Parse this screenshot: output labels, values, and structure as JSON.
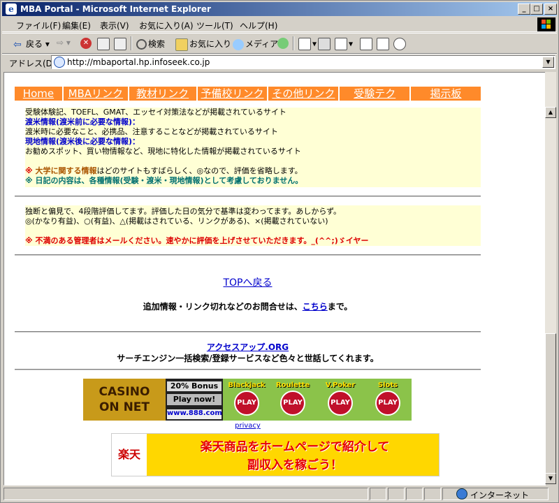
{
  "window": {
    "title": "MBA Portal - Microsoft Internet Explorer"
  },
  "menu": [
    "ファイル(F)",
    "編集(E)",
    "表示(V)",
    "お気に入り(A)",
    "ツール(T)",
    "ヘルプ(H)"
  ],
  "toolbar": {
    "back": "戻る",
    "search": "検索",
    "favorites": "お気に入り",
    "media": "メディア"
  },
  "address": {
    "label": "アドレス(D)",
    "url": "http://mbaportal.hp.infoseek.co.jp"
  },
  "nav": [
    "Home",
    "MBAリンク",
    "教材リンク",
    "予備校リンク",
    "その他リンク",
    "受験テク",
    "掲示板"
  ],
  "legend": {
    "line1": "受験体験記、TOEFL、GMAT、エッセイ対策法などが掲載されているサイト",
    "pre_title": "渡米情報(渡米前に必要な情報)：",
    "pre_desc": "渡米時に必要なこと、必携品、注意することなどが掲載されているサイト",
    "local_title": "現地情報(渡米後に必要な情報)：",
    "local_desc": "お勧めスポット、買い物情報など、現地に特化した情報が掲載されているサイト",
    "note1_mark": "※ ",
    "note1_strong": "大学に関する情報",
    "note1_rest": "はどのサイトもすばらしく、◎なので、評価を省略します。",
    "note2": "※ 日記の内容は、各種情報(受験・渡米・現地情報)として考慮しておりません。"
  },
  "rating": {
    "line1": "独断と偏見で、4段階評価してます。評価した日の気分で基準は変わってます。あしからず。",
    "line2": "◎(かなり有益)、○(有益)、△(掲載はされている、リンクがある)、×(掲載されていない)",
    "note": "※ 不満のある管理者はメールください。速やかに評価を上げさせていただきます。_(^^;)ゞイヤー"
  },
  "top_link": "TOPへ戻る",
  "contact": {
    "text": "追加情報・リンク切れなどのお問合せは、",
    "link": "こちら",
    "suffix": "まで。"
  },
  "access_up": {
    "link": "アクセスアップ.ORG",
    "desc": "サーチエンジン一括検索/登録サービスなど色々と世話してくれます。"
  },
  "casino": {
    "logo_top": "CASINO",
    "logo_bottom": "ON NET",
    "bonus": "20% Bonus",
    "play": "Play now!",
    "site": "www.888.com",
    "games": [
      "Blackjack",
      "Roulette",
      "V.Poker",
      "Slots"
    ],
    "chip_label": "PLAY",
    "privacy": "privacy"
  },
  "rakuten": {
    "logo": "楽天",
    "line1": "楽天商品をホームページで紹介して",
    "line2": "副収入を稼ごう！"
  },
  "status": {
    "zone": "インターネット"
  }
}
